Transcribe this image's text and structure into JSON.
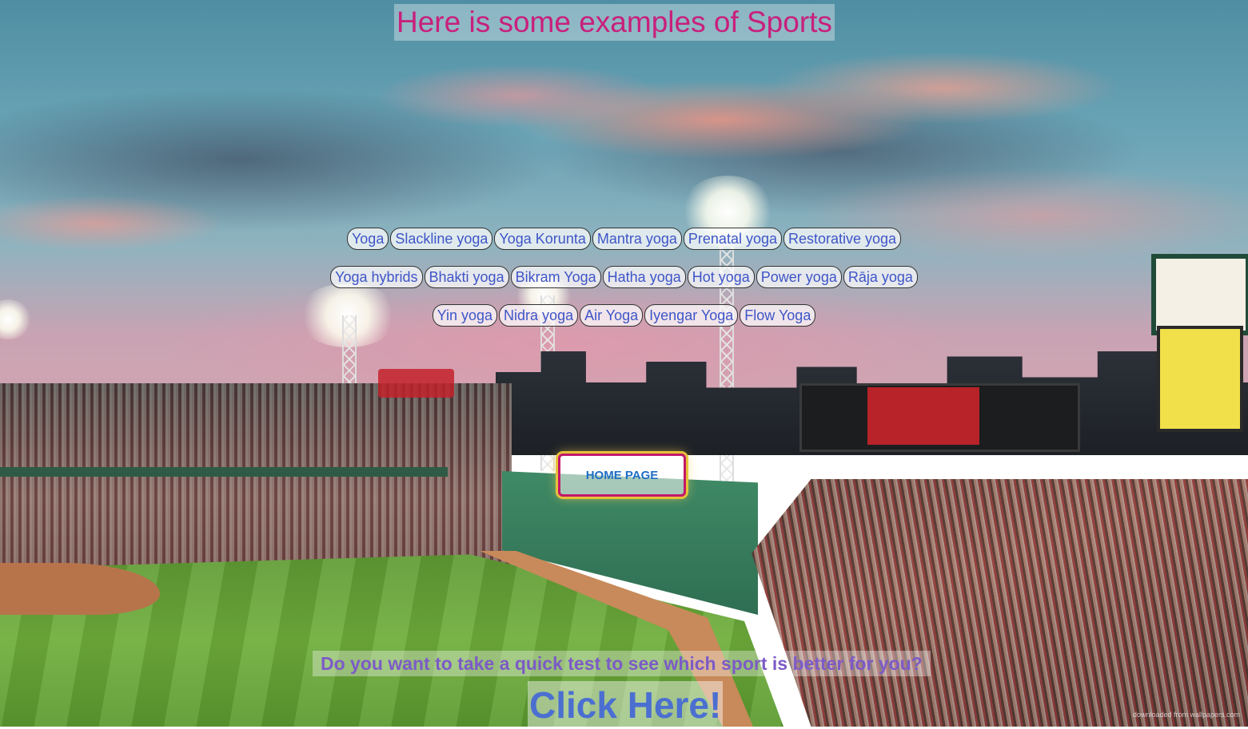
{
  "page": {
    "title": "Here is some examples of Sports",
    "background_icon": "stadium-photo",
    "credit": "downloaded from wallpapers.com"
  },
  "links": {
    "rows": [
      [
        "Yoga",
        "Slackline yoga",
        "Yoga Korunta",
        "Mantra yoga",
        "Prenatal yoga",
        "Restorative yoga"
      ],
      [
        "Yoga hybrids",
        "Bhakti yoga",
        "Bikram Yoga",
        "Hatha yoga",
        "Hot yoga",
        "Power yoga",
        "Rāja yoga"
      ],
      [
        "Yin yoga",
        "Nidra yoga",
        "Air Yoga",
        "Iyengar Yoga",
        "Flow Yoga"
      ]
    ]
  },
  "home_button": {
    "label": "HOME PAGE"
  },
  "quiz": {
    "question": "Do you want to take a quick test to see which sport is better for you?",
    "link_label": "Click Here!"
  },
  "colors": {
    "title": "#c8207c",
    "link_text": "#3f55c8",
    "home_border": "#c2186b",
    "home_glow": "#e6c23a",
    "question": "#7c5bc7",
    "click_here": "#4b6fd0"
  }
}
